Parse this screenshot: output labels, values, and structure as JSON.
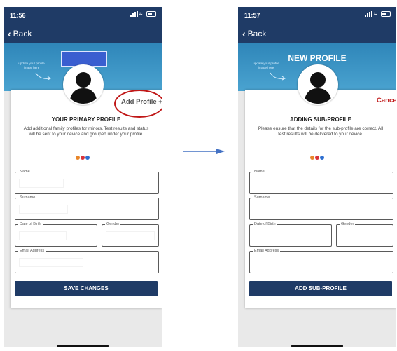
{
  "left": {
    "status_time": "11:56",
    "back_label": "Back",
    "banner_hint": "update your profile image here",
    "add_profile_label": "Add Profile +",
    "title": "YOUR PRIMARY PROFILE",
    "description": "Add additional family profiles for minors.  Test results and status will be sent to your device and grouped under your profile.",
    "fields": {
      "name": "Name",
      "surname": "Surname",
      "dob": "Date of Birth",
      "gender": "Gender",
      "email": "Email Address"
    },
    "button": "SAVE CHANGES"
  },
  "right": {
    "status_time": "11:57",
    "back_label": "Back",
    "header_title": "NEW PROFILE",
    "banner_hint": "update your profile image here",
    "cancel_label": "Cancel",
    "title": "ADDING SUB-PROFILE",
    "description": "Please ensure that the details for the sub-profile are correct. All test results will be delivered to your device.",
    "fields": {
      "name": "Name",
      "surname": "Surname",
      "dob": "Date of Birth",
      "gender": "Gender",
      "email": "Email Address"
    },
    "button": "ADD SUB-PROFILE"
  },
  "colors": {
    "nav": "#1f3b66",
    "banner": "#3a97c8",
    "highlight_circle": "#c01818",
    "transition_arrow": "#4472c4",
    "dot_orange": "#e8862a",
    "dot_red": "#d8343a",
    "dot_blue": "#2f6fd0"
  },
  "icons": {
    "status_location": "location-arrow-icon",
    "back": "chevron-left-icon",
    "avatar": "person-silhouette-icon",
    "transition": "right-arrow-icon"
  }
}
